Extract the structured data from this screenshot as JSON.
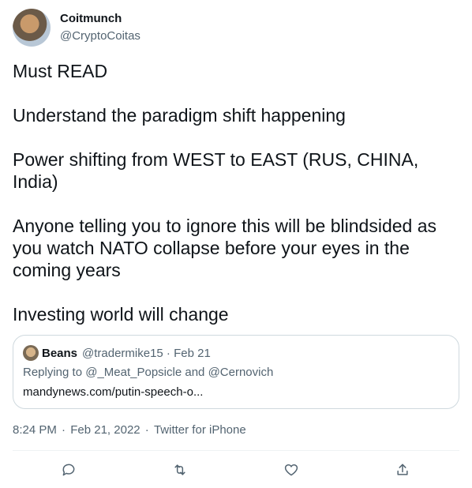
{
  "author": {
    "display_name": "Coitmunch",
    "handle": "@CryptoCoitas"
  },
  "body": {
    "paragraphs": [
      "Must READ",
      "Understand the paradigm shift happening",
      "Power shifting from WEST to EAST (RUS, CHINA, India)",
      "Anyone telling you to ignore this will be blindsided as you watch NATO collapse before your eyes in the coming years",
      "Investing world will change"
    ]
  },
  "quote": {
    "name": "Beans",
    "handle_date": "@tradermike15 · Feb 21",
    "reply_prefix": "Replying to ",
    "reply_user1": "@_Meat_Popsicle",
    "reply_and": " and ",
    "reply_user2": "@Cernovich",
    "url": "mandynews.com/putin-speech-o..."
  },
  "meta": {
    "time": "8:24 PM",
    "sep1": " · ",
    "date": "Feb 21, 2022",
    "sep2": " · ",
    "source": "Twitter for iPhone"
  },
  "actions": {
    "reply_icon": "reply-icon",
    "retweet_icon": "retweet-icon",
    "like_icon": "heart-icon",
    "share_icon": "share-icon",
    "icon_color": "#536471"
  }
}
